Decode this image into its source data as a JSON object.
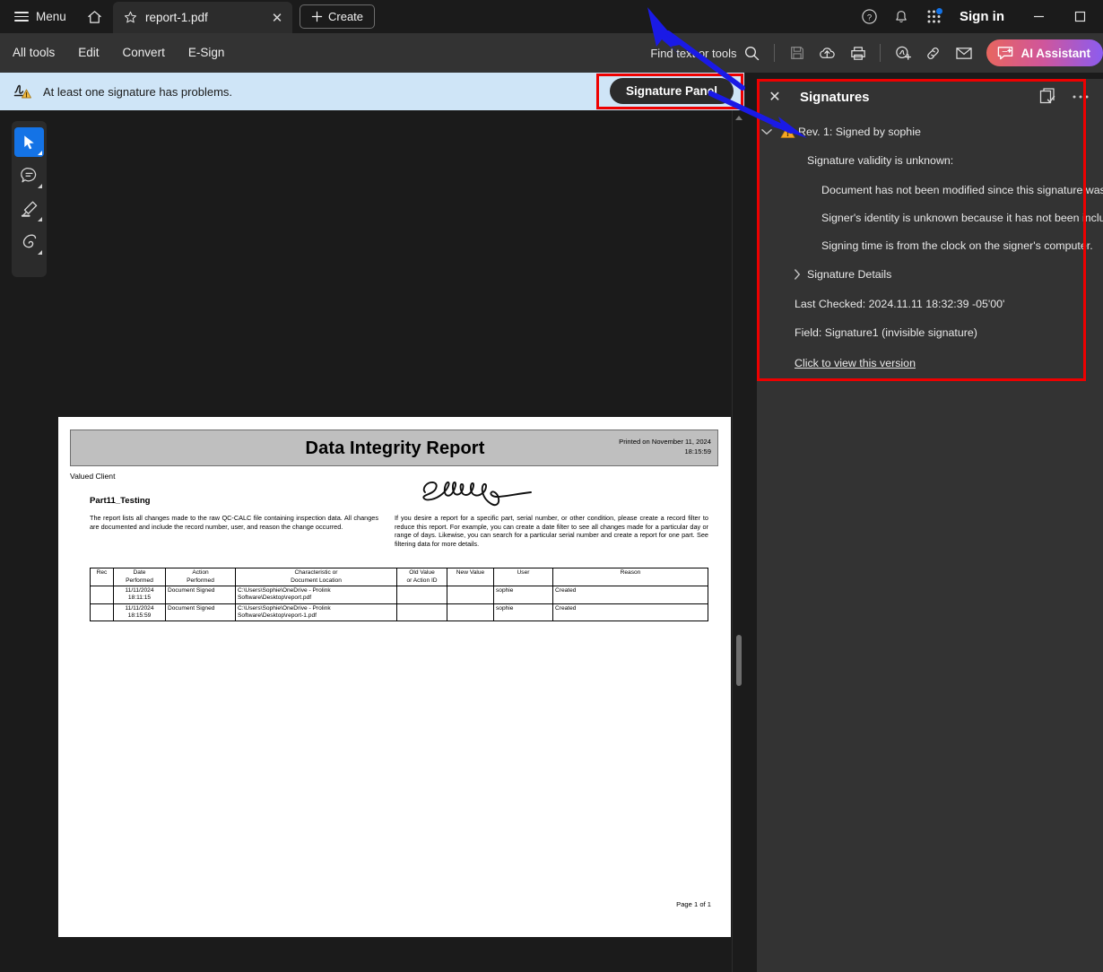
{
  "titlebar": {
    "menu_label": "Menu",
    "home_icon": "home-icon",
    "tab": {
      "title": "report-1.pdf",
      "star_icon": "star-icon",
      "close_icon": "close-icon"
    },
    "create_label": "Create",
    "help_icon": "help-circle-icon",
    "bell_icon": "bell-icon",
    "apps_icon": "app-grid-icon",
    "signin_label": "Sign in",
    "minimize_icon": "minimize-icon",
    "maximize_icon": "maximize-icon"
  },
  "toolbar": {
    "items": [
      {
        "label": "All tools"
      },
      {
        "label": "Edit"
      },
      {
        "label": "Convert"
      },
      {
        "label": "E-Sign"
      }
    ],
    "find_label": "Find text or tools",
    "search_icon": "search-icon",
    "save_icon": "save-icon",
    "cloud_icon": "cloud-upload-icon",
    "print_icon": "print-icon",
    "request_signature_icon": "request-esignature-icon",
    "link_icon": "link-icon",
    "email_icon": "email-icon",
    "ai_label": "AI Assistant",
    "ai_icon": "ai-assistant-icon"
  },
  "notification_bar": {
    "icon": "signature-warning-icon",
    "message": "At least one signature has problems.",
    "button_label": "Signature Panel"
  },
  "left_rail": {
    "tools": [
      {
        "name": "select-tool",
        "icon": "cursor-icon",
        "active": true
      },
      {
        "name": "comment-tool",
        "icon": "comment-icon",
        "active": false
      },
      {
        "name": "highlight-tool",
        "icon": "highlighter-icon",
        "active": false
      },
      {
        "name": "draw-tool",
        "icon": "draw-loop-icon",
        "active": false
      }
    ]
  },
  "signatures_panel": {
    "title": "Signatures",
    "close_icon": "close-icon",
    "validate_all_icon": "validate-all-signatures-icon",
    "options_icon": "more-options-icon",
    "revision": {
      "chevron_icon": "chevron-down-icon",
      "warning_icon": "warning-triangle-icon",
      "label": "Rev. 1: Signed by sophie"
    },
    "validity_heading": "Signature validity is unknown:",
    "validity_details": [
      "Document has not been modified since this signature was applied",
      "Signer's identity is unknown because it has not been included in"
    ],
    "signing_time_note": "Signing time is from the clock on the signer's computer.",
    "details_label": "Signature Details",
    "details_chevron_icon": "chevron-right-icon",
    "last_checked": "Last Checked: 2024.11.11 18:32:39 -05'00'",
    "field": "Field: Signature1 (invisible signature)",
    "view_version_link": "Click to view this version"
  },
  "document": {
    "title": "Data Integrity Report",
    "printed_on": "Printed on November 11, 2024",
    "printed_time": "18:15:59",
    "client": "Valued Client",
    "part": "Part11_Testing",
    "signature_alt": "handwritten-signature-sophie-jane",
    "paragraph_left": "The report lists all changes made to the raw QC-CALC file containing inspection data. All changes are documented and include the record number, user, and reason the change occurred.",
    "paragraph_right": "If you desire a report for a specific part, serial number, or other condition, please create a record filter to reduce this report. For example, you can create a date filter to see all changes made for a particular day or range of days. Likewise, you can search for a particular serial number and create a report for one part. See filtering data for more details.",
    "table": {
      "headers": [
        "Rec",
        "Date\nPerformed",
        "Action\nPerformed",
        "Characteristic or\nDocument Location",
        "Old Value\nor Action ID",
        "New Value",
        "User",
        "Reason"
      ],
      "rows": [
        {
          "rec": "",
          "date": "11/11/2024 18:11:15",
          "date_line1": "11/11/2024",
          "date_line2": "18:11:15",
          "action": "Document Signed",
          "location_line1": "C:\\Users\\Sophie\\OneDrive - Prolink",
          "location_line2": "Software\\Desktop\\report.pdf",
          "old_value": "",
          "new_value": "",
          "user": "sophie",
          "reason": "Created"
        },
        {
          "rec": "",
          "date": "11/11/2024 18:15:59",
          "date_line1": "11/11/2024",
          "date_line2": "18:15:59",
          "action": "Document Signed",
          "location_line1": "C:\\Users\\Sophie\\OneDrive - Prolink",
          "location_line2": "Software\\Desktop\\report-1.pdf",
          "old_value": "",
          "new_value": "",
          "user": "sophie",
          "reason": "Created"
        }
      ]
    },
    "page_footer": "Page  1  of  1"
  },
  "annotations": {
    "highlight_color": "#ee0000",
    "arrow_color": "#1a1ae6",
    "arrow_top_target": "signature-panel-button",
    "arrow_panel_target": "revision-row"
  },
  "colors": {
    "titlebar_bg": "#1b1b1b",
    "toolbar_bg": "#333333",
    "panel_bg": "#333333",
    "viewer_bg": "#1b1b1b",
    "notification_bg": "#cfe5f7",
    "accent_blue": "#1473e6",
    "warning_amber": "#f5a623"
  }
}
